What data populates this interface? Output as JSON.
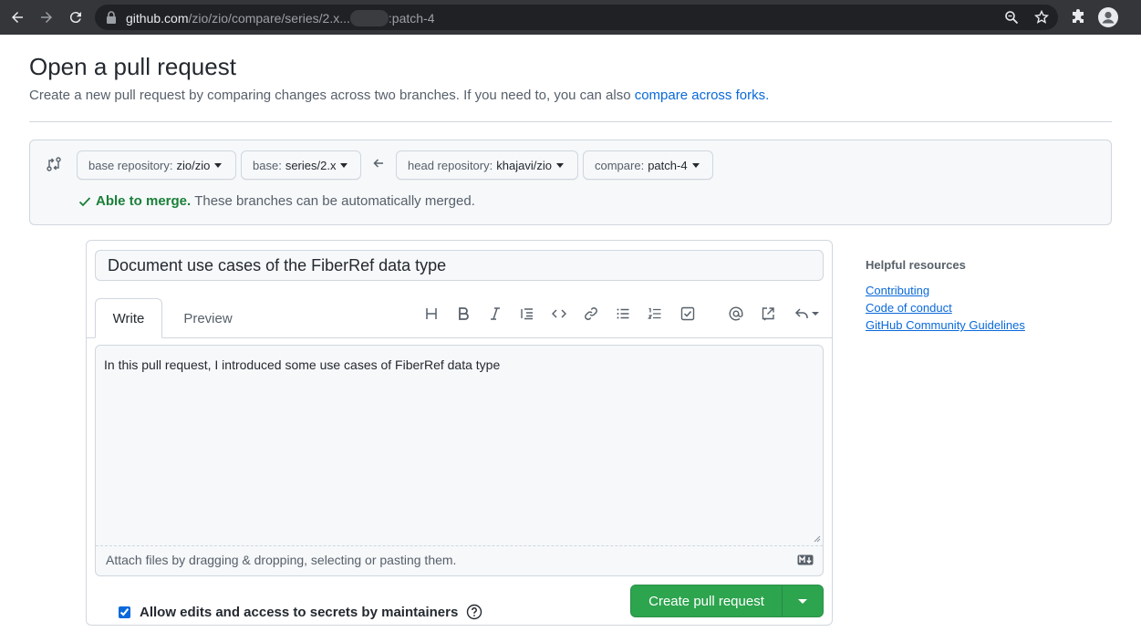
{
  "browser": {
    "url_host": "github.com",
    "url_path_1": "/zio/zio/compare/series/2.x...",
    "url_path_2": ":patch-4"
  },
  "page": {
    "title": "Open a pull request",
    "subtitle": "Create a new pull request by comparing changes across two branches. If you need to, you can also ",
    "subtitle_link": "compare across forks."
  },
  "range": {
    "base_repo_label": "base repository:",
    "base_repo_value": "zio/zio",
    "base_label": "base:",
    "base_value": "series/2.x",
    "head_repo_label": "head repository:",
    "head_repo_value": "khajavi/zio",
    "compare_label": "compare:",
    "compare_value": "patch-4",
    "merge_strong": "Able to merge.",
    "merge_text": "These branches can be automatically merged."
  },
  "form": {
    "title_value": "Document use cases of the FiberRef data type",
    "tab_write": "Write",
    "tab_preview": "Preview",
    "body_value": "In this pull request, I introduced some use cases of FiberRef data type",
    "attach_hint": "Attach files by dragging & dropping, selecting or pasting them.",
    "allow_edits_label": "Allow edits and access to secrets by maintainers",
    "allow_edits_checked": true,
    "create_button": "Create pull request"
  },
  "sidebar": {
    "heading": "Helpful resources",
    "links": [
      "Contributing",
      "Code of conduct",
      "GitHub Community Guidelines"
    ]
  },
  "colors": {
    "primary_button": "#2da44e",
    "link": "#0969da",
    "success": "#1a7f37",
    "chrome_bg": "#35363a"
  }
}
